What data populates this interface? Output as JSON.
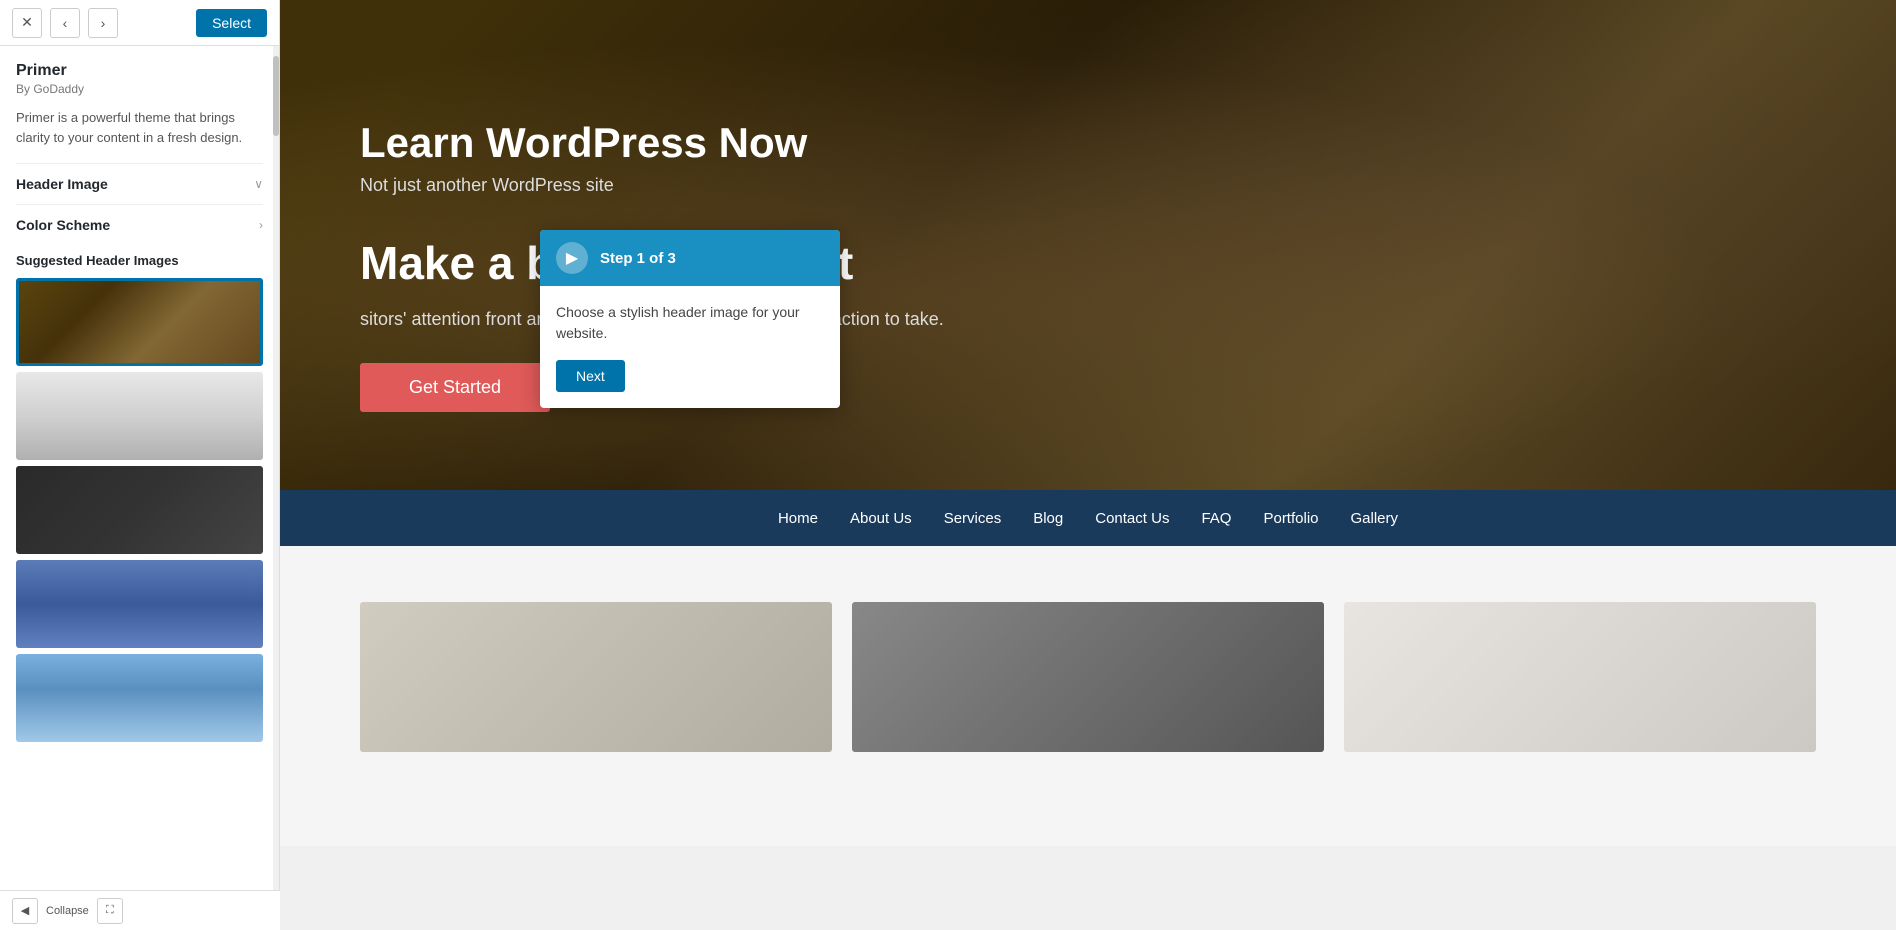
{
  "panel": {
    "theme_name": "Primer",
    "theme_author": "By GoDaddy",
    "theme_description": "Primer is a powerful theme that brings clarity to your content in a fresh design.",
    "select_btn": "Select",
    "back_btn": "‹",
    "forward_btn": "›",
    "close_btn": "✕",
    "header_image_label": "Header Image",
    "color_scheme_label": "Color Scheme",
    "suggested_label": "Suggested Header Images",
    "collapse_btn": "Collapse"
  },
  "step_popup": {
    "step_label": "Step 1 of 3",
    "step_icon": "▶",
    "step_body": "Choose a stylish header image for your website.",
    "next_btn": "Next"
  },
  "hero": {
    "site_title": "Learn WordPress Now",
    "site_tagline": "Not just another WordPress site",
    "bold_statement": "Make a bold statement",
    "hero_body": "sitors' attention front and center on your homepage, then n action to take.",
    "cta_btn": "Get Started"
  },
  "nav": {
    "items": [
      {
        "label": "Home"
      },
      {
        "label": "About Us"
      },
      {
        "label": "Services"
      },
      {
        "label": "Blog"
      },
      {
        "label": "Contact Us"
      },
      {
        "label": "FAQ"
      },
      {
        "label": "Portfolio"
      },
      {
        "label": "Gallery"
      }
    ]
  },
  "bottom_bar": {
    "hide_icon": "◀",
    "expand_icon": "⛶",
    "collapse_label": "Collapse"
  }
}
